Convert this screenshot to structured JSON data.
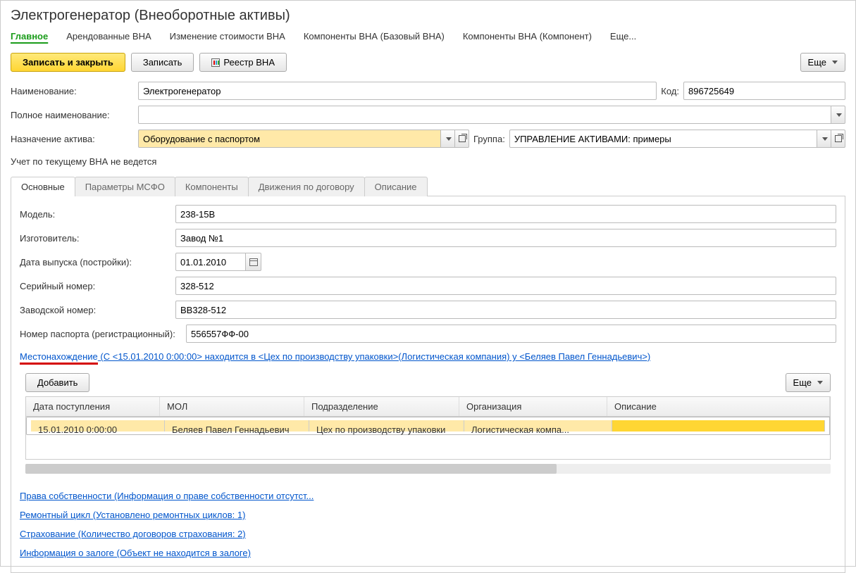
{
  "window": {
    "title": "Электрогенератор (Внеоборотные активы)"
  },
  "nav": {
    "items": [
      "Главное",
      "Арендованные ВНА",
      "Изменение стоимости ВНА",
      "Компоненты ВНА (Базовый ВНА)",
      "Компоненты ВНА (Компонент)",
      "Еще..."
    ],
    "active": 0
  },
  "toolbar": {
    "save_close": "Записать и закрыть",
    "save": "Записать",
    "registry": "Реестр ВНА",
    "more": "Еще"
  },
  "fields": {
    "name_lbl": "Наименование:",
    "name_val": "Электрогенератор",
    "code_lbl": "Код:",
    "code_val": "896725649",
    "fullname_lbl": "Полное наименование:",
    "fullname_val": "",
    "purpose_lbl": "Назначение актива:",
    "purpose_val": "Оборудование с паспортом",
    "group_lbl": "Группа:",
    "group_val": "УПРАВЛЕНИЕ АКТИВАМИ: примеры",
    "note": "Учет по текущему ВНА не ведется"
  },
  "subtabs": {
    "items": [
      "Основные",
      "Параметры МСФО",
      "Компоненты",
      "Движения по договору",
      "Описание"
    ],
    "active": 0
  },
  "main": {
    "model_lbl": "Модель:",
    "model_val": "238-15В",
    "manuf_lbl": "Изготовитель:",
    "manuf_val": "Завод №1",
    "proddate_lbl": "Дата выпуска (постройки):",
    "proddate_val": "01.01.2010",
    "serial_lbl": "Серийный номер:",
    "serial_val": "328-512",
    "factory_lbl": "Заводской номер:",
    "factory_val": "ВВ328-512",
    "passport_lbl": "Номер паспорта (регистрационный):",
    "passport_val": "556557ФФ-00"
  },
  "location": {
    "title": "Местонахождение (С <15.01.2010 0:00:00> находится в <Цех по производству упаковки>(Логистическая компания) у <Беляев Павел Геннадьевич>)",
    "add_btn": "Добавить",
    "more_btn": "Еще",
    "cols": [
      "Дата поступления",
      "МОЛ",
      "Подразделение",
      "Организация",
      "Описание"
    ],
    "row": {
      "date": "15.01.2010 0:00:00",
      "mol": "Беляев Павел Геннадьевич",
      "dept": "Цех по производству упаковки",
      "org": "Логистическая компа...",
      "desc": ""
    }
  },
  "links": {
    "ownership": "Права собственности (Информация о праве собственности отсутст...",
    "repair": "Ремонтный цикл (Установлено ремонтных циклов: 1)",
    "insurance": "Страхование (Количество договоров страхования: 2)",
    "pledge": "Информация о залоге (Объект не находится в залоге)"
  }
}
